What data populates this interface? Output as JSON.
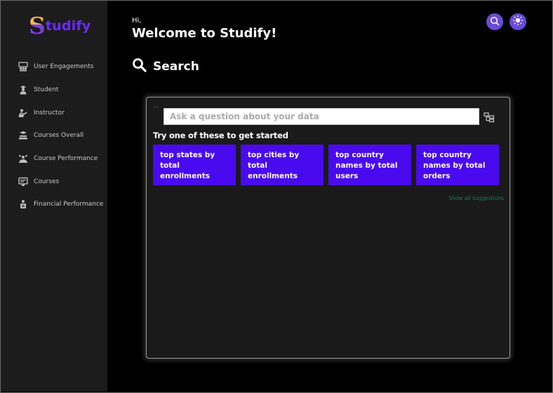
{
  "app": {
    "logo_initial": "S",
    "logo_rest": "tudify"
  },
  "sidebar": {
    "items": [
      {
        "label": "User Engagements",
        "icon": "user-engagements-icon"
      },
      {
        "label": "Student",
        "icon": "student-icon"
      },
      {
        "label": "Instructor",
        "icon": "instructor-icon"
      },
      {
        "label": "Courses Overall",
        "icon": "courses-overall-icon"
      },
      {
        "label": "Course Performance",
        "icon": "course-performance-icon"
      },
      {
        "label": "Courses",
        "icon": "courses-icon"
      },
      {
        "label": "Financial Performance",
        "icon": "financial-performance-icon"
      }
    ]
  },
  "header": {
    "greeting": "Hi,",
    "welcome": "Welcome to Studify!",
    "search_button_icon": "search-icon",
    "theme_button_icon": "sun-icon"
  },
  "search": {
    "heading": "Search",
    "placeholder": "Ask a question about your data",
    "value": "",
    "try_label": "Try one of these to get started",
    "suggestions": [
      "top states by total enrollments",
      "top cities by total enrollments",
      "top country names by total users",
      "top country names by total orders"
    ],
    "show_all": "Show all suggestions"
  },
  "colors": {
    "background": "#000000",
    "sidebar": "#1c1c1c",
    "panel": "#1a1a1a",
    "accent": "#4a0af0",
    "header_button": "#6a4bd8",
    "show_all_link": "#1e7a58"
  }
}
